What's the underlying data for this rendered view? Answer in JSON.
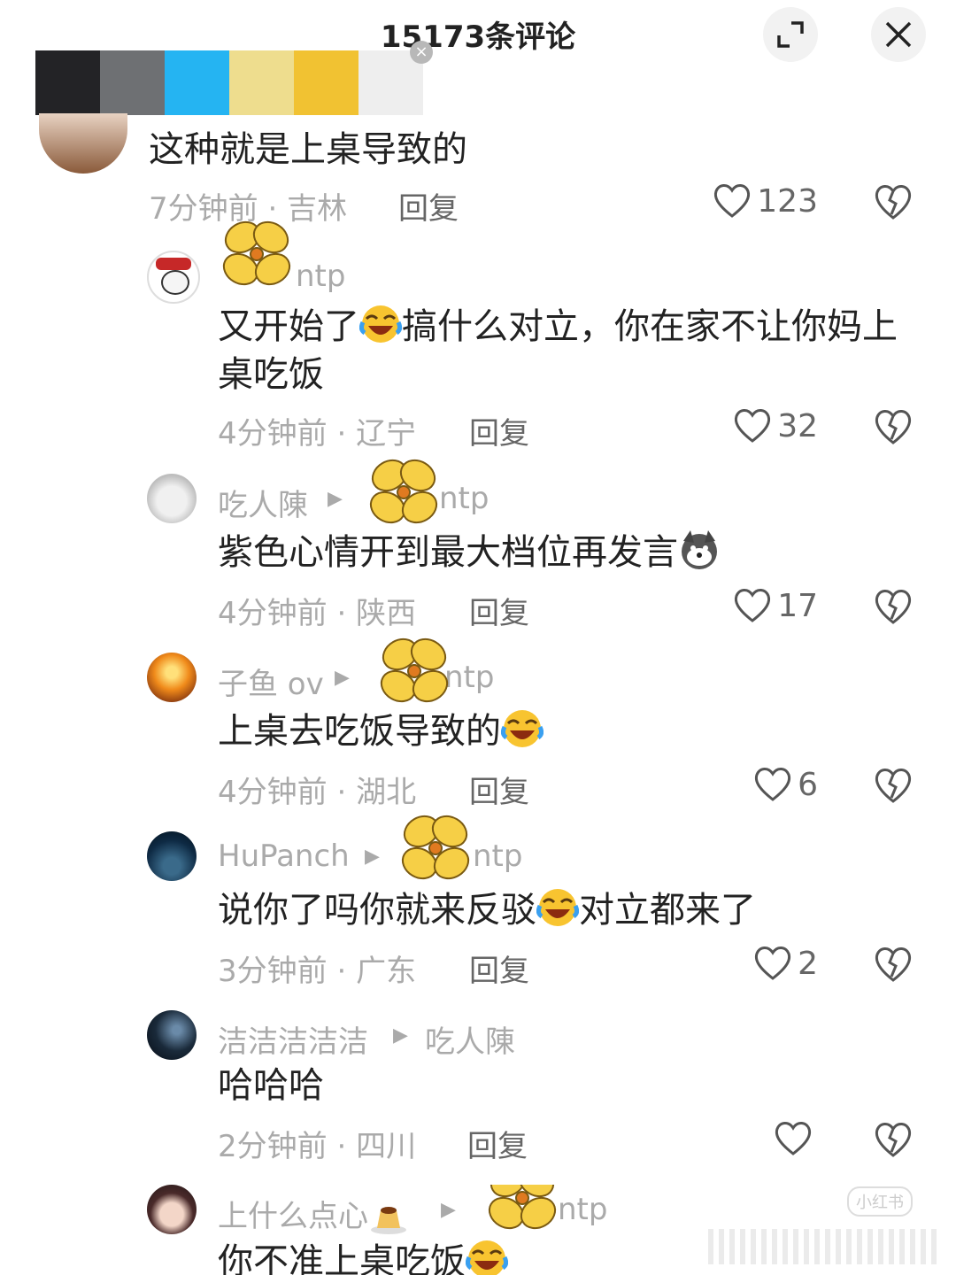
{
  "header": {
    "title": "15173条评论"
  },
  "palette": {
    "colors": [
      "#232326",
      "#6e7073",
      "#25b4f2",
      "#eedd8e",
      "#f1c232",
      "#eeeeee"
    ]
  },
  "comments": [
    {
      "text": "这种就是上桌导致的",
      "time": "7分钟前",
      "region": "吉林",
      "reply": "回复",
      "likes": "123"
    },
    {
      "user": "ntp",
      "text": "又开始了",
      "text2": "搞什么对立，你在家不让你妈上桌吃饭",
      "time": "4分钟前",
      "region": "辽宁",
      "reply": "回复",
      "likes": "32"
    },
    {
      "user": "吃人陳",
      "target": "ntp",
      "text": "紫色心情开到最大档位再发言",
      "time": "4分钟前",
      "region": "陕西",
      "reply": "回复",
      "likes": "17"
    },
    {
      "user": "子鱼 ov",
      "target": "ntp",
      "text": "上桌去吃饭导致的",
      "time": "4分钟前",
      "region": "湖北",
      "reply": "回复",
      "likes": "6"
    },
    {
      "user": "HuPanch",
      "target": "ntp",
      "text": "说你了吗你就来反驳",
      "text2": "对立都来了",
      "time": "3分钟前",
      "region": "广东",
      "reply": "回复",
      "likes": "2"
    },
    {
      "user": "洁洁洁洁洁",
      "target": "吃人陳",
      "text": "哈哈哈",
      "time": "2分钟前",
      "region": "四川",
      "reply": "回复",
      "likes": ""
    },
    {
      "user": "上什么点心",
      "target": "ntp",
      "text": "你不准上桌吃饭"
    }
  ],
  "meta_sep": " · ",
  "watermark": "小红书"
}
